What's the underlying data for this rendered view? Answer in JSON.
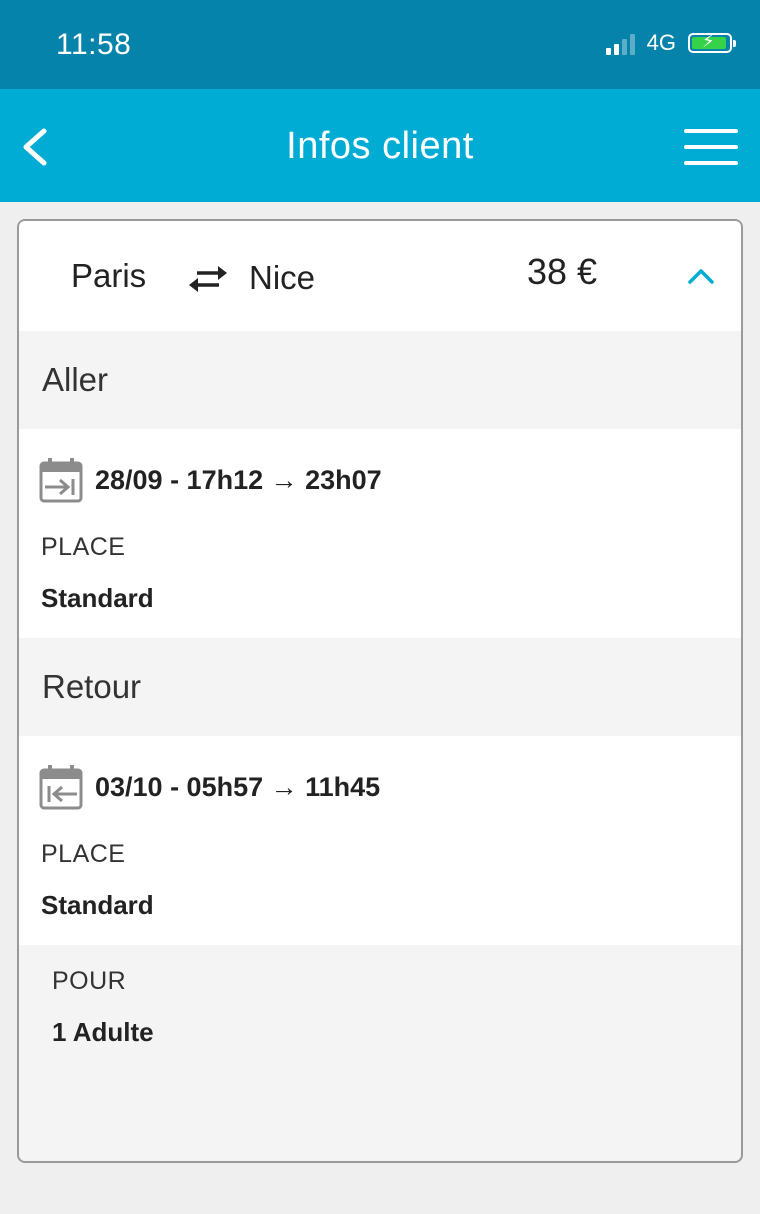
{
  "status": {
    "time": "11:58",
    "network": "4G"
  },
  "nav": {
    "title": "Infos client"
  },
  "summary": {
    "from": "Paris",
    "to": "Nice",
    "price": "38 €"
  },
  "outbound": {
    "section": "Aller",
    "schedule": "28/09 - 17h12 → 23h07",
    "place_label": "PLACE",
    "place_value": "Standard"
  },
  "return": {
    "section": "Retour",
    "schedule": "03/10 - 05h57 → 11h45",
    "place_label": "PLACE",
    "place_value": "Standard"
  },
  "passengers": {
    "label": "POUR",
    "value": "1 Adulte"
  },
  "colors": {
    "statusbar": "#0683ab",
    "navbar": "#00acd3",
    "accent": "#00acd3"
  }
}
